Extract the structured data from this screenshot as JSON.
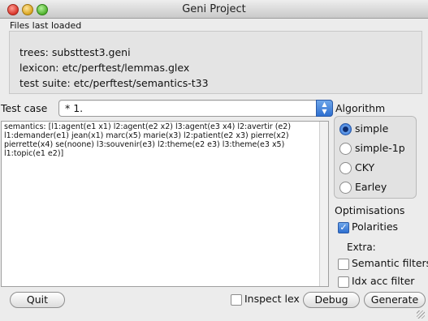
{
  "window": {
    "title": "Geni Project"
  },
  "files": {
    "heading": "Files last loaded",
    "trees": "trees: substtest3.geni",
    "lexicon": "lexicon: etc/perftest/lemmas.glex",
    "test_suite": "test suite: etc/perftest/semantics-t33"
  },
  "test_case": {
    "label": "Test case",
    "selected": "* 1."
  },
  "semantics": {
    "text": "semantics: [l1:agent(e1 x1) l2:agent(e2 x2) l3:agent(e3 x4) l2:avertir (e2) l1:demander(e1) jean(x1) marc(x5) marie(x3) l2:patient(e2 x3) pierre(x2) pierrette(x4) se(noone) l3:souvenir(e3) l2:theme(e2 e3) l3:theme(e3 x5) l1:topic(e1 e2)]"
  },
  "algorithm": {
    "label": "Algorithm",
    "options": [
      {
        "label": "simple",
        "selected": true
      },
      {
        "label": "simple-1p",
        "selected": false
      },
      {
        "label": "CKY",
        "selected": false
      },
      {
        "label": "Earley",
        "selected": false
      }
    ]
  },
  "optimisations": {
    "label": "Optimisations",
    "polarities": {
      "label": "Polarities",
      "checked": true
    },
    "extra_label": "Extra:",
    "semantic_filters": {
      "label": "Semantic filters",
      "checked": false
    },
    "idx_acc_filter": {
      "label": "Idx acc filter",
      "checked": false
    }
  },
  "bottom": {
    "quit": "Quit",
    "inspect_lex": "Inspect lex",
    "debug": "Debug",
    "generate": "Generate"
  },
  "colors": {
    "accent": "#3b78d8"
  }
}
